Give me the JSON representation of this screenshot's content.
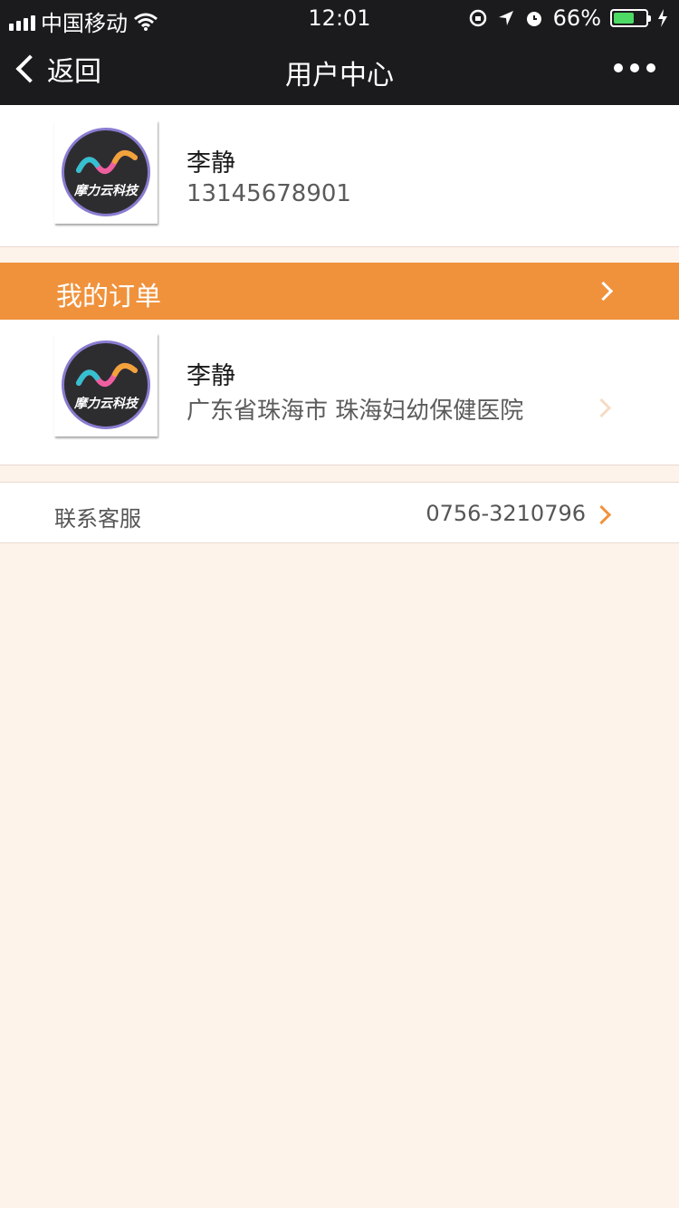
{
  "status_bar": {
    "carrier": "中国移动",
    "time": "12:01",
    "battery_percent": "66%",
    "battery_level": 0.66,
    "icons": [
      "signal-icon",
      "wifi-icon",
      "rotation-lock-icon",
      "location-arrow-icon",
      "alarm-icon",
      "battery-icon",
      "charging-icon"
    ]
  },
  "nav": {
    "back_label": "返回",
    "title": "用户中心",
    "more_icon": "more-dots-icon"
  },
  "profile": {
    "logo_text": "摩力云科技",
    "name": "李静",
    "phone": "13145678901"
  },
  "orders": {
    "header": "我的订单",
    "item": {
      "logo_text": "摩力云科技",
      "name": "李静",
      "location": "广东省珠海市 珠海妇幼保健医院"
    }
  },
  "contact": {
    "label": "联系客服",
    "phone": "0756-3210796"
  },
  "colors": {
    "nav_bg": "#1b1b1d",
    "accent": "#f0923c",
    "page_bg": "#fdf3ea"
  }
}
